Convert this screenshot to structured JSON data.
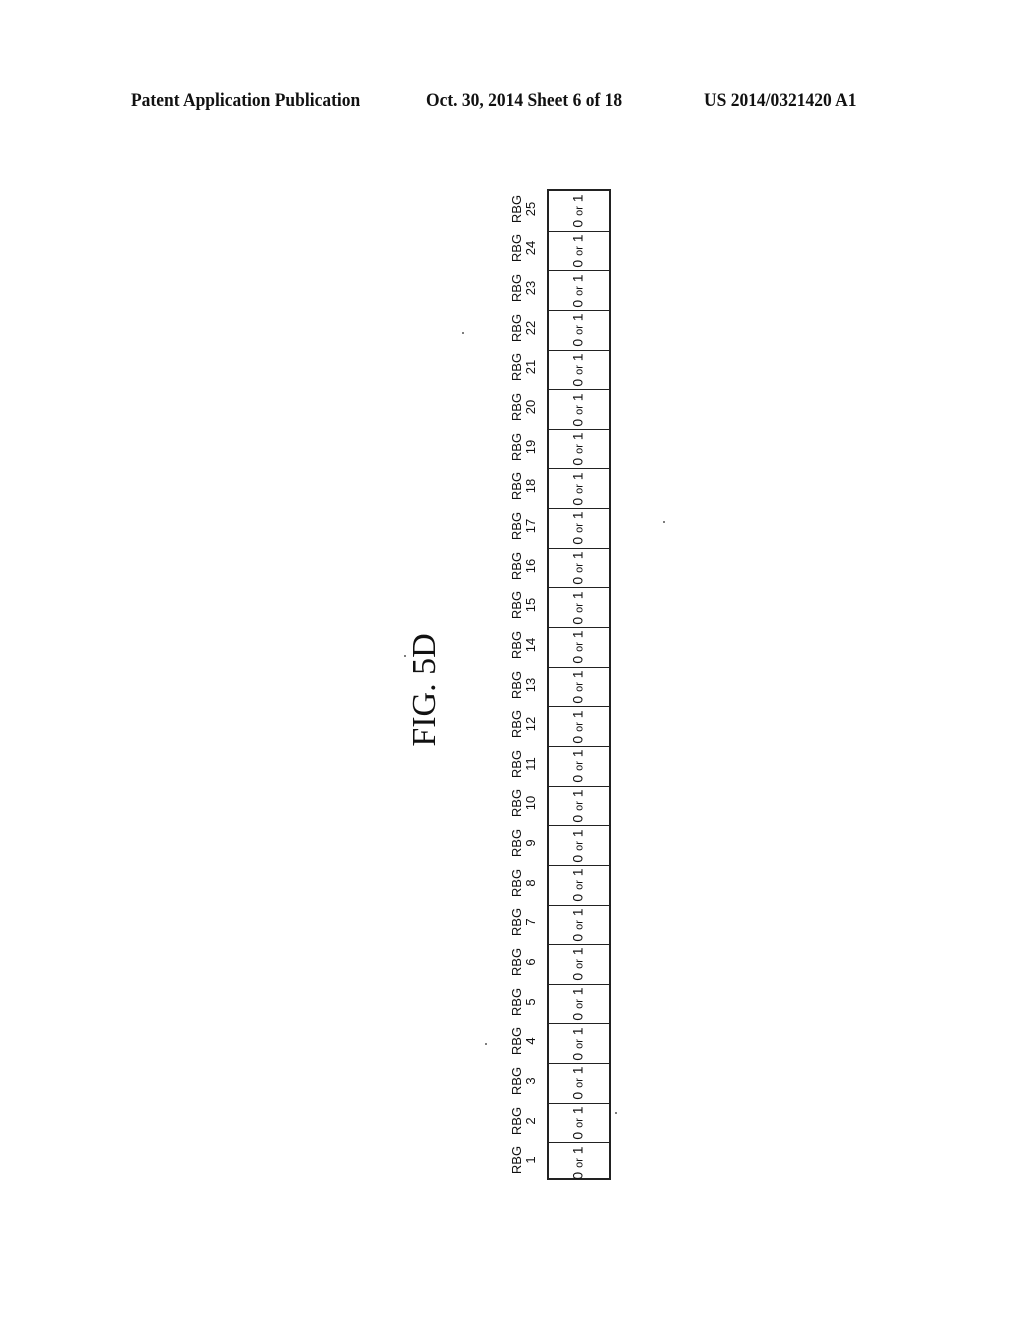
{
  "header": {
    "left": "Patent Application Publication",
    "middle": "Oct. 30, 2014   Sheet 6 of 18",
    "right": "US 2014/0321420 A1"
  },
  "figure": {
    "caption": "FIG. 5D",
    "fields": [
      {
        "label": "RBG",
        "index": "1",
        "value": [
          "0",
          "or",
          "1"
        ]
      },
      {
        "label": "RBG",
        "index": "2",
        "value": [
          "0",
          "or",
          "1"
        ]
      },
      {
        "label": "RBG",
        "index": "3",
        "value": [
          "0",
          "or",
          "1"
        ]
      },
      {
        "label": "RBG",
        "index": "4",
        "value": [
          "0",
          "or",
          "1"
        ]
      },
      {
        "label": "RBG",
        "index": "5",
        "value": [
          "0",
          "or",
          "1"
        ]
      },
      {
        "label": "RBG",
        "index": "6",
        "value": [
          "0",
          "or",
          "1"
        ]
      },
      {
        "label": "RBG",
        "index": "7",
        "value": [
          "0",
          "or",
          "1"
        ]
      },
      {
        "label": "RBG",
        "index": "8",
        "value": [
          "0",
          "or",
          "1"
        ]
      },
      {
        "label": "RBG",
        "index": "9",
        "value": [
          "0",
          "or",
          "1"
        ]
      },
      {
        "label": "RBG",
        "index": "10",
        "value": [
          "0",
          "or",
          "1"
        ]
      },
      {
        "label": "RBG",
        "index": "11",
        "value": [
          "0",
          "or",
          "1"
        ]
      },
      {
        "label": "RBG",
        "index": "12",
        "value": [
          "0",
          "or",
          "1"
        ]
      },
      {
        "label": "RBG",
        "index": "13",
        "value": [
          "0",
          "or",
          "1"
        ]
      },
      {
        "label": "RBG",
        "index": "14",
        "value": [
          "0",
          "or",
          "1"
        ]
      },
      {
        "label": "RBG",
        "index": "15",
        "value": [
          "0",
          "or",
          "1"
        ]
      },
      {
        "label": "RBG",
        "index": "16",
        "value": [
          "0",
          "or",
          "1"
        ]
      },
      {
        "label": "RBG",
        "index": "17",
        "value": [
          "0",
          "or",
          "1"
        ]
      },
      {
        "label": "RBG",
        "index": "18",
        "value": [
          "0",
          "or",
          "1"
        ]
      },
      {
        "label": "RBG",
        "index": "19",
        "value": [
          "0",
          "or",
          "1"
        ]
      },
      {
        "label": "RBG",
        "index": "20",
        "value": [
          "0",
          "or",
          "1"
        ]
      },
      {
        "label": "RBG",
        "index": "21",
        "value": [
          "0",
          "or",
          "1"
        ]
      },
      {
        "label": "RBG",
        "index": "22",
        "value": [
          "0",
          "or",
          "1"
        ]
      },
      {
        "label": "RBG",
        "index": "23",
        "value": [
          "0",
          "or",
          "1"
        ]
      },
      {
        "label": "RBG",
        "index": "24",
        "value": [
          "0",
          "or",
          "1"
        ]
      },
      {
        "label": "RBG",
        "index": "25",
        "value": [
          "0",
          "or",
          "1"
        ]
      }
    ]
  }
}
